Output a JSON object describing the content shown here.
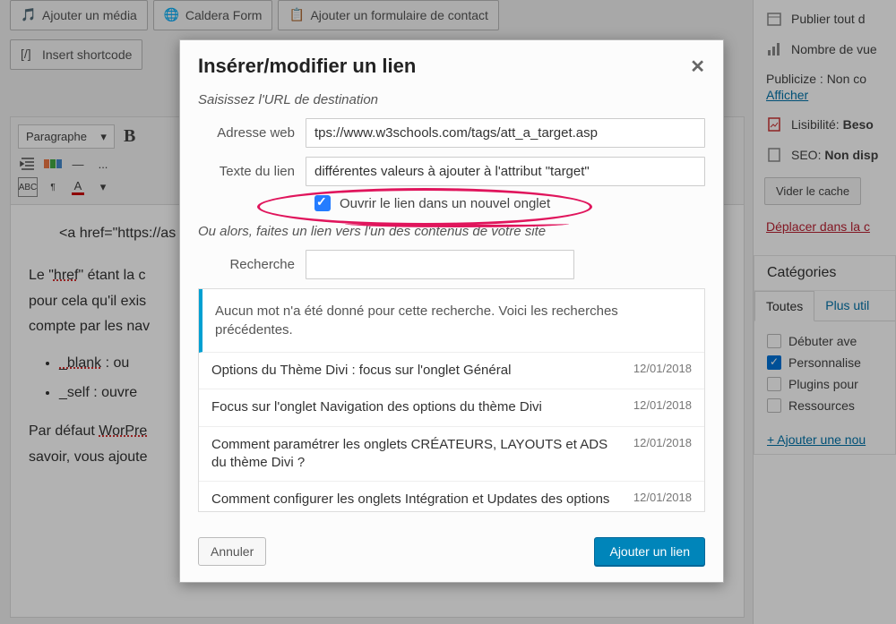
{
  "bg_toolbar": {
    "add_media": "Ajouter un média",
    "caldera": "Caldera Form",
    "contact_form": "Ajouter un formulaire de contact",
    "shortcode": "Insert shortcode"
  },
  "editor": {
    "format_dropdown": "Paragraphe",
    "content_line1_pre": "<a href=\"https://as",
    "content_line2_pre": "Le \"",
    "content_line2_wavy": "href",
    "content_line2_rest": "\" étant la c",
    "content_line3": "pour cela qu'il exis",
    "content_line4": "compte par les nav",
    "bullet_blank_name": "_blank",
    "bullet_blank_text": " : ou",
    "bullet_self_name": "_self",
    "bullet_self_text": " : ouvre",
    "content_line5_pre": "Par défaut ",
    "content_line5_wavy": "WorPre",
    "content_line6": "savoir, vous ajoute"
  },
  "modal": {
    "title": "Insérer/modifier un lien",
    "instruction1": "Saisissez l'URL de destination",
    "url_label": "Adresse web",
    "url_value": "tps://www.w3schools.com/tags/att_a_target.asp",
    "text_label": "Texte du lien",
    "text_value": "différentes valeurs à ajouter à l'attribut \"target\"",
    "newtab_label": "Ouvrir le lien dans un nouvel onglet",
    "instruction2": "Ou alors, faites un lien vers l'un des contenus de votre site",
    "search_label": "Recherche",
    "search_value": "",
    "empty_msg": "Aucun mot n'a été donné pour cette recherche. Voici les recherches précédentes.",
    "results": [
      {
        "title": "Options du Thème Divi : focus sur l'onglet Général",
        "date": "12/01/2018"
      },
      {
        "title": "Focus sur l'onglet Navigation des options du thème Divi",
        "date": "12/01/2018"
      },
      {
        "title": "Comment paramétrer les onglets CRÉATEURS, LAYOUTS et ADS du thème Divi ?",
        "date": "12/01/2018"
      },
      {
        "title": "Comment configurer les onglets Intégration et Updates des options du thème Divi ?",
        "date": "12/01/2018"
      }
    ],
    "cancel": "Annuler",
    "submit": "Ajouter un lien"
  },
  "sidebar": {
    "publish": "Publier tout d",
    "views": "Nombre de vue",
    "publicize": "Publicize : Non co",
    "show": "Afficher",
    "readability_label": "Lisibilité: ",
    "readability_value": "Beso",
    "seo_label": "SEO: ",
    "seo_value": "Non disp",
    "clear_cache": "Vider le cache",
    "move_trash": "Déplacer dans la c",
    "categories_title": "Catégories",
    "tab_all": "Toutes",
    "tab_used": "Plus util",
    "cats": [
      {
        "label": "Débuter ave",
        "checked": false
      },
      {
        "label": "Personnalise",
        "checked": true
      },
      {
        "label": "Plugins pour",
        "checked": false
      },
      {
        "label": "Ressources",
        "checked": false
      }
    ],
    "add_cat": "+ Ajouter une nou"
  }
}
